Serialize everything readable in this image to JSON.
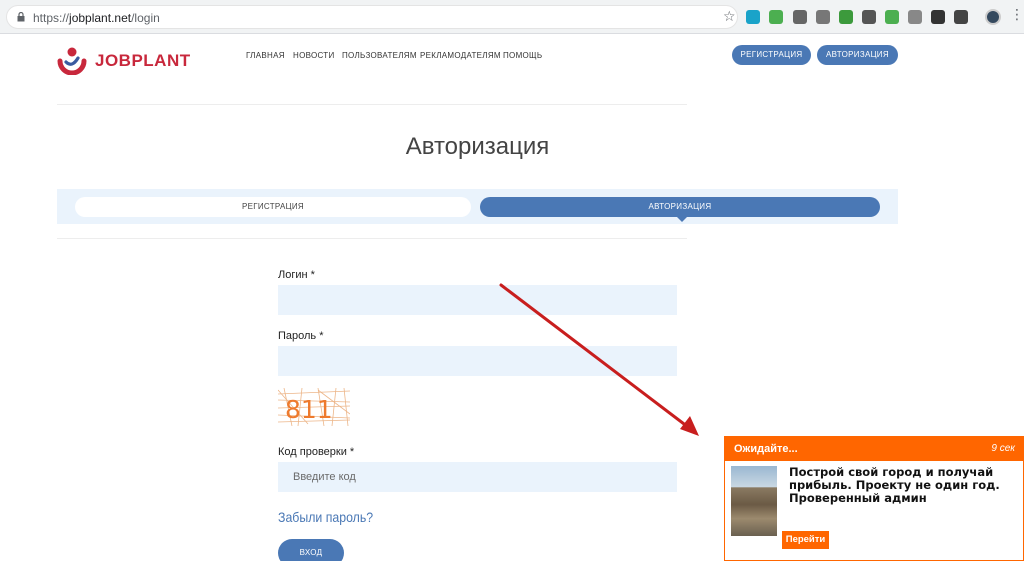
{
  "browser": {
    "url_scheme": "https://",
    "url_host": "jobplant.net",
    "url_path": "/login",
    "star_glyph": "☆",
    "menu_glyph": "⋮",
    "extension_colors": [
      "#1aa3c9",
      "#4caf50",
      "#666666",
      "#777777",
      "#3c9a3c",
      "#555555",
      "#4caf50",
      "#888888",
      "#333333",
      "#444444"
    ]
  },
  "header": {
    "logo_text": "JOBPLANT",
    "nav": [
      "ГЛАВНАЯ",
      "НОВОСТИ",
      "ПОЛЬЗОВАТЕЛЯМ",
      "РЕКЛАМОДАТЕЛЯМ",
      "ПОМОЩЬ"
    ],
    "register_button": "РЕГИСТРАЦИЯ",
    "login_button": "АВТОРИЗАЦИЯ"
  },
  "page": {
    "title": "Авторизация"
  },
  "tabs": {
    "register": "РЕГИСТРАЦИЯ",
    "login": "АВТОРИЗАЦИЯ",
    "active": "login"
  },
  "form": {
    "login_label": "Логин *",
    "login_value": "",
    "password_label": "Пароль *",
    "password_value": "",
    "captcha_text": "811",
    "code_label": "Код проверки *",
    "code_placeholder": "Введите код",
    "forgot_link": "Забыли пароль?",
    "submit_label": "ВХОД"
  },
  "ad": {
    "wait_label": "Ожидайте...",
    "timer": "9 сек",
    "text": "Построй свой город и получай прибыль. Проекту не один год. Проверенный админ",
    "button_label": "Перейти"
  },
  "colors": {
    "brand_red": "#c8283c",
    "primary_blue": "#4a78b5",
    "field_bg": "#eaf3fc",
    "ad_orange": "#ff6600",
    "annotation_arrow": "#c81e1e"
  }
}
